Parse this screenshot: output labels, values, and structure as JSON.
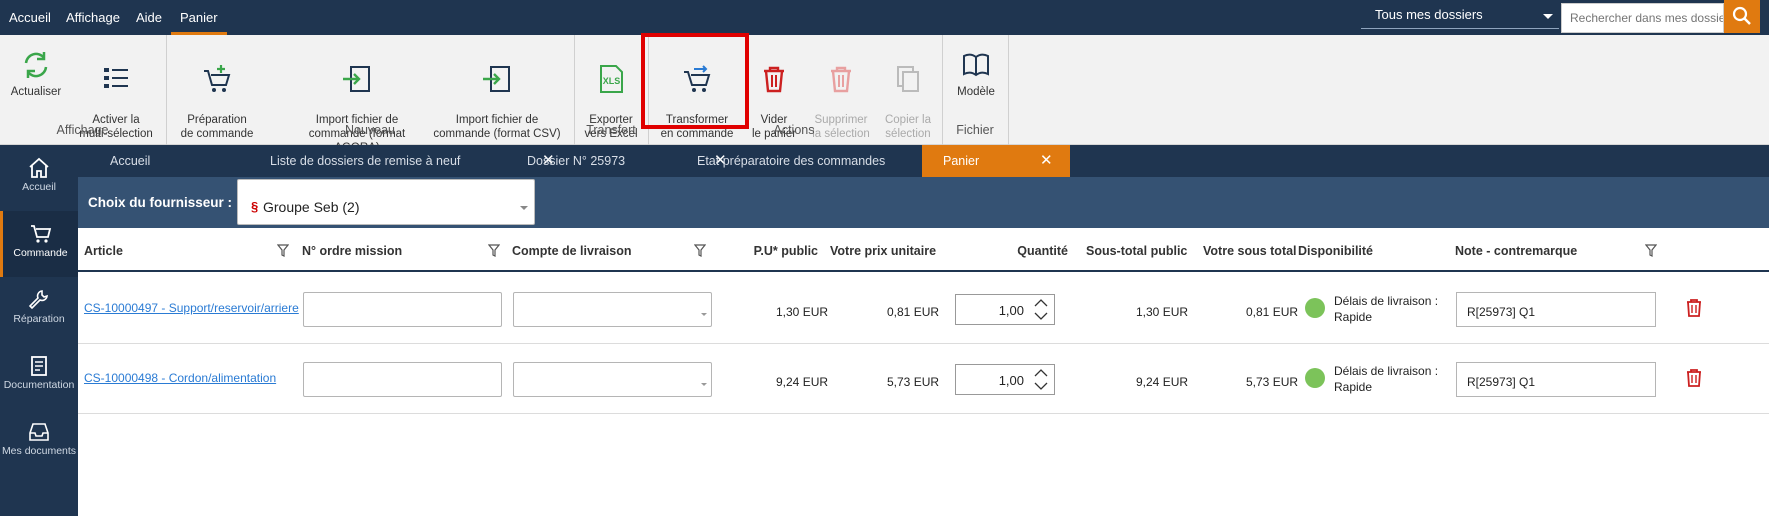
{
  "menubar": {
    "items": [
      "Accueil",
      "Affichage",
      "Aide",
      "Panier"
    ],
    "active": "Panier"
  },
  "folder_select": {
    "value": "Tous mes dossiers"
  },
  "search": {
    "placeholder": "Rechercher dans mes dossiers"
  },
  "ribbon": {
    "buttons": {
      "actualiser": "Actualiser",
      "multiselect": "Activer la\nmulti-sélection",
      "preparation": "Préparation\nde commande",
      "import_agora": "Import fichier de\ncommande (format AGORA)",
      "import_csv": "Import fichier de\ncommande (format CSV)",
      "export_excel": "Exporter\nvers Excel",
      "transformer": "Transformer\nen commande",
      "vider": "Vider\nle panier",
      "supprimer": "Supprimer\nla sélection",
      "copier": "Copier la\nsélection",
      "modele": "Modèle"
    },
    "groups": {
      "affichage": "Affichage",
      "nouveau": "Nouveau",
      "transfert": "Transfert",
      "actions": "Actions",
      "fichier": "Fichier"
    }
  },
  "leftnav": [
    "Accueil",
    "Commande",
    "Réparation",
    "Documentation",
    "Mes documents"
  ],
  "tabs": [
    "Accueil",
    "Liste de dossiers de remise à neuf",
    "Dossier N° 25973",
    "Etat préparatoire des commandes",
    "Panier"
  ],
  "supplier": {
    "label": "Choix du fournisseur :",
    "value": "Groupe Seb (2)"
  },
  "table": {
    "headers": {
      "article": "Article",
      "ordre": "N° ordre mission",
      "compte": "Compte de livraison",
      "pu_public": "P.U* public",
      "votre_prix": "Votre prix unitaire",
      "quantite": "Quantité",
      "sous_total_public": "Sous-total public",
      "votre_sous_total": "Votre sous total",
      "dispo": "Disponibilité",
      "note": "Note - contremarque"
    },
    "rows": [
      {
        "article": "CS-10000497 - Support/reservoir/arriere",
        "pu_public": "1,30 EUR",
        "votre_prix": "0,81 EUR",
        "quantite": "1,00",
        "sous_total_public": "1,30 EUR",
        "votre_sous_total": "0,81 EUR",
        "dispo_line1": "Délais de livraison :",
        "dispo_line2": "Rapide",
        "note": "R[25973] Q1"
      },
      {
        "article": "CS-10000498 - Cordon/alimentation",
        "pu_public": "9,24 EUR",
        "votre_prix": "5,73 EUR",
        "quantite": "1,00",
        "sous_total_public": "9,24 EUR",
        "votre_sous_total": "5,73 EUR",
        "dispo_line1": "Délais de livraison :",
        "dispo_line2": "Rapide",
        "note": "R[25973] Q1"
      }
    ]
  },
  "colors": {
    "navy": "#1f3550",
    "accent": "#e07a10",
    "supplier_bar": "#355273",
    "available": "#7cc35a"
  }
}
